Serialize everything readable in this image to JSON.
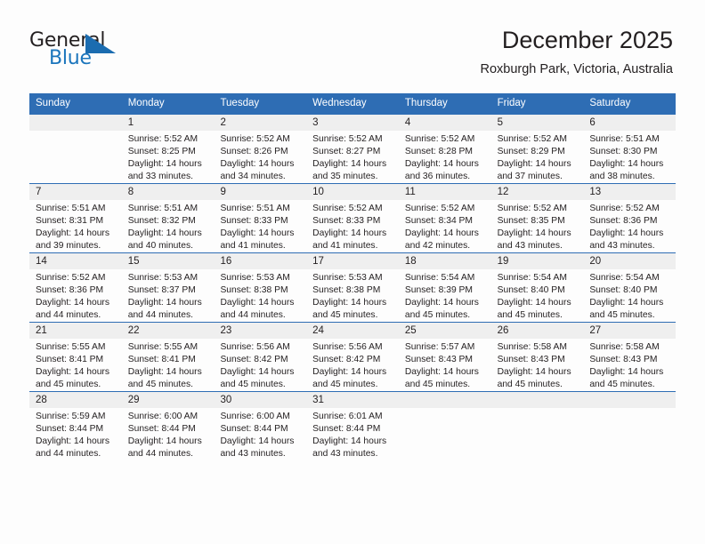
{
  "brand": {
    "name_part1": "General",
    "name_part2": "Blue",
    "accent_color": "#1b6cb0"
  },
  "header": {
    "title": "December 2025",
    "subtitle": "Roxburgh Park, Victoria, Australia"
  },
  "theme": {
    "header_blue": "#2e6db4",
    "daynum_gray": "#efefef",
    "text": "#231f20"
  },
  "weekdays": [
    "Sunday",
    "Monday",
    "Tuesday",
    "Wednesday",
    "Thursday",
    "Friday",
    "Saturday"
  ],
  "weeks": [
    [
      {
        "day": "",
        "l1": "",
        "l2": "",
        "l3": "",
        "l4": ""
      },
      {
        "day": "1",
        "l1": "Sunrise: 5:52 AM",
        "l2": "Sunset: 8:25 PM",
        "l3": "Daylight: 14 hours",
        "l4": "and 33 minutes."
      },
      {
        "day": "2",
        "l1": "Sunrise: 5:52 AM",
        "l2": "Sunset: 8:26 PM",
        "l3": "Daylight: 14 hours",
        "l4": "and 34 minutes."
      },
      {
        "day": "3",
        "l1": "Sunrise: 5:52 AM",
        "l2": "Sunset: 8:27 PM",
        "l3": "Daylight: 14 hours",
        "l4": "and 35 minutes."
      },
      {
        "day": "4",
        "l1": "Sunrise: 5:52 AM",
        "l2": "Sunset: 8:28 PM",
        "l3": "Daylight: 14 hours",
        "l4": "and 36 minutes."
      },
      {
        "day": "5",
        "l1": "Sunrise: 5:52 AM",
        "l2": "Sunset: 8:29 PM",
        "l3": "Daylight: 14 hours",
        "l4": "and 37 minutes."
      },
      {
        "day": "6",
        "l1": "Sunrise: 5:51 AM",
        "l2": "Sunset: 8:30 PM",
        "l3": "Daylight: 14 hours",
        "l4": "and 38 minutes."
      }
    ],
    [
      {
        "day": "7",
        "l1": "Sunrise: 5:51 AM",
        "l2": "Sunset: 8:31 PM",
        "l3": "Daylight: 14 hours",
        "l4": "and 39 minutes."
      },
      {
        "day": "8",
        "l1": "Sunrise: 5:51 AM",
        "l2": "Sunset: 8:32 PM",
        "l3": "Daylight: 14 hours",
        "l4": "and 40 minutes."
      },
      {
        "day": "9",
        "l1": "Sunrise: 5:51 AM",
        "l2": "Sunset: 8:33 PM",
        "l3": "Daylight: 14 hours",
        "l4": "and 41 minutes."
      },
      {
        "day": "10",
        "l1": "Sunrise: 5:52 AM",
        "l2": "Sunset: 8:33 PM",
        "l3": "Daylight: 14 hours",
        "l4": "and 41 minutes."
      },
      {
        "day": "11",
        "l1": "Sunrise: 5:52 AM",
        "l2": "Sunset: 8:34 PM",
        "l3": "Daylight: 14 hours",
        "l4": "and 42 minutes."
      },
      {
        "day": "12",
        "l1": "Sunrise: 5:52 AM",
        "l2": "Sunset: 8:35 PM",
        "l3": "Daylight: 14 hours",
        "l4": "and 43 minutes."
      },
      {
        "day": "13",
        "l1": "Sunrise: 5:52 AM",
        "l2": "Sunset: 8:36 PM",
        "l3": "Daylight: 14 hours",
        "l4": "and 43 minutes."
      }
    ],
    [
      {
        "day": "14",
        "l1": "Sunrise: 5:52 AM",
        "l2": "Sunset: 8:36 PM",
        "l3": "Daylight: 14 hours",
        "l4": "and 44 minutes."
      },
      {
        "day": "15",
        "l1": "Sunrise: 5:53 AM",
        "l2": "Sunset: 8:37 PM",
        "l3": "Daylight: 14 hours",
        "l4": "and 44 minutes."
      },
      {
        "day": "16",
        "l1": "Sunrise: 5:53 AM",
        "l2": "Sunset: 8:38 PM",
        "l3": "Daylight: 14 hours",
        "l4": "and 44 minutes."
      },
      {
        "day": "17",
        "l1": "Sunrise: 5:53 AM",
        "l2": "Sunset: 8:38 PM",
        "l3": "Daylight: 14 hours",
        "l4": "and 45 minutes."
      },
      {
        "day": "18",
        "l1": "Sunrise: 5:54 AM",
        "l2": "Sunset: 8:39 PM",
        "l3": "Daylight: 14 hours",
        "l4": "and 45 minutes."
      },
      {
        "day": "19",
        "l1": "Sunrise: 5:54 AM",
        "l2": "Sunset: 8:40 PM",
        "l3": "Daylight: 14 hours",
        "l4": "and 45 minutes."
      },
      {
        "day": "20",
        "l1": "Sunrise: 5:54 AM",
        "l2": "Sunset: 8:40 PM",
        "l3": "Daylight: 14 hours",
        "l4": "and 45 minutes."
      }
    ],
    [
      {
        "day": "21",
        "l1": "Sunrise: 5:55 AM",
        "l2": "Sunset: 8:41 PM",
        "l3": "Daylight: 14 hours",
        "l4": "and 45 minutes."
      },
      {
        "day": "22",
        "l1": "Sunrise: 5:55 AM",
        "l2": "Sunset: 8:41 PM",
        "l3": "Daylight: 14 hours",
        "l4": "and 45 minutes."
      },
      {
        "day": "23",
        "l1": "Sunrise: 5:56 AM",
        "l2": "Sunset: 8:42 PM",
        "l3": "Daylight: 14 hours",
        "l4": "and 45 minutes."
      },
      {
        "day": "24",
        "l1": "Sunrise: 5:56 AM",
        "l2": "Sunset: 8:42 PM",
        "l3": "Daylight: 14 hours",
        "l4": "and 45 minutes."
      },
      {
        "day": "25",
        "l1": "Sunrise: 5:57 AM",
        "l2": "Sunset: 8:43 PM",
        "l3": "Daylight: 14 hours",
        "l4": "and 45 minutes."
      },
      {
        "day": "26",
        "l1": "Sunrise: 5:58 AM",
        "l2": "Sunset: 8:43 PM",
        "l3": "Daylight: 14 hours",
        "l4": "and 45 minutes."
      },
      {
        "day": "27",
        "l1": "Sunrise: 5:58 AM",
        "l2": "Sunset: 8:43 PM",
        "l3": "Daylight: 14 hours",
        "l4": "and 45 minutes."
      }
    ],
    [
      {
        "day": "28",
        "l1": "Sunrise: 5:59 AM",
        "l2": "Sunset: 8:44 PM",
        "l3": "Daylight: 14 hours",
        "l4": "and 44 minutes."
      },
      {
        "day": "29",
        "l1": "Sunrise: 6:00 AM",
        "l2": "Sunset: 8:44 PM",
        "l3": "Daylight: 14 hours",
        "l4": "and 44 minutes."
      },
      {
        "day": "30",
        "l1": "Sunrise: 6:00 AM",
        "l2": "Sunset: 8:44 PM",
        "l3": "Daylight: 14 hours",
        "l4": "and 43 minutes."
      },
      {
        "day": "31",
        "l1": "Sunrise: 6:01 AM",
        "l2": "Sunset: 8:44 PM",
        "l3": "Daylight: 14 hours",
        "l4": "and 43 minutes."
      },
      {
        "day": "",
        "l1": "",
        "l2": "",
        "l3": "",
        "l4": ""
      },
      {
        "day": "",
        "l1": "",
        "l2": "",
        "l3": "",
        "l4": ""
      },
      {
        "day": "",
        "l1": "",
        "l2": "",
        "l3": "",
        "l4": ""
      }
    ]
  ]
}
